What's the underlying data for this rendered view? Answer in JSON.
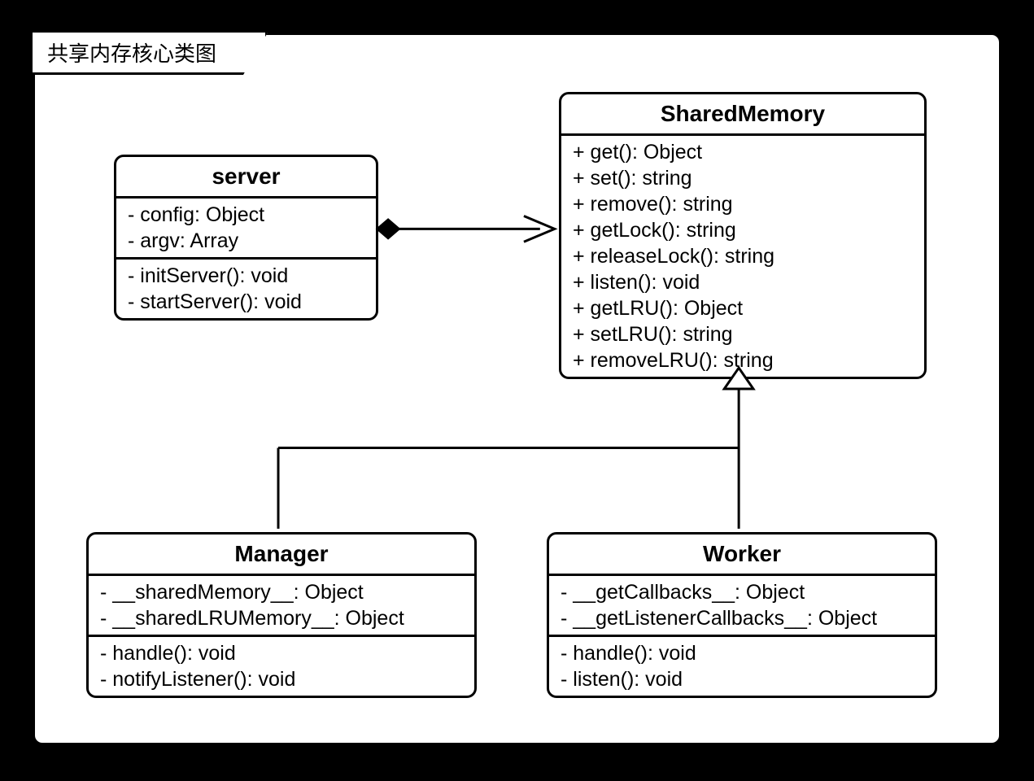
{
  "diagram": {
    "title": "共享内存核心类图",
    "classes": {
      "server": {
        "name": "server",
        "attributes": [
          "- config: Object",
          "- argv: Array"
        ],
        "methods": [
          "- initServer(): void",
          "- startServer(): void"
        ]
      },
      "sharedMemory": {
        "name": "SharedMemory",
        "attributes": [],
        "methods": [
          "+ get(): Object",
          "+ set(): string",
          "+ remove(): string",
          "+ getLock(): string",
          "+ releaseLock(): string",
          "+ listen(): void",
          "+ getLRU(): Object",
          "+ setLRU(): string",
          "+ removeLRU(): string"
        ]
      },
      "manager": {
        "name": "Manager",
        "attributes": [
          "- __sharedMemory__: Object",
          "- __sharedLRUMemory__: Object"
        ],
        "methods": [
          "- handle(): void",
          "- notifyListener(): void"
        ]
      },
      "worker": {
        "name": "Worker",
        "attributes": [
          "- __getCallbacks__: Object",
          "- __getListenerCallbacks__: Object"
        ],
        "methods": [
          "- handle(): void",
          "- listen(): void"
        ]
      }
    }
  }
}
